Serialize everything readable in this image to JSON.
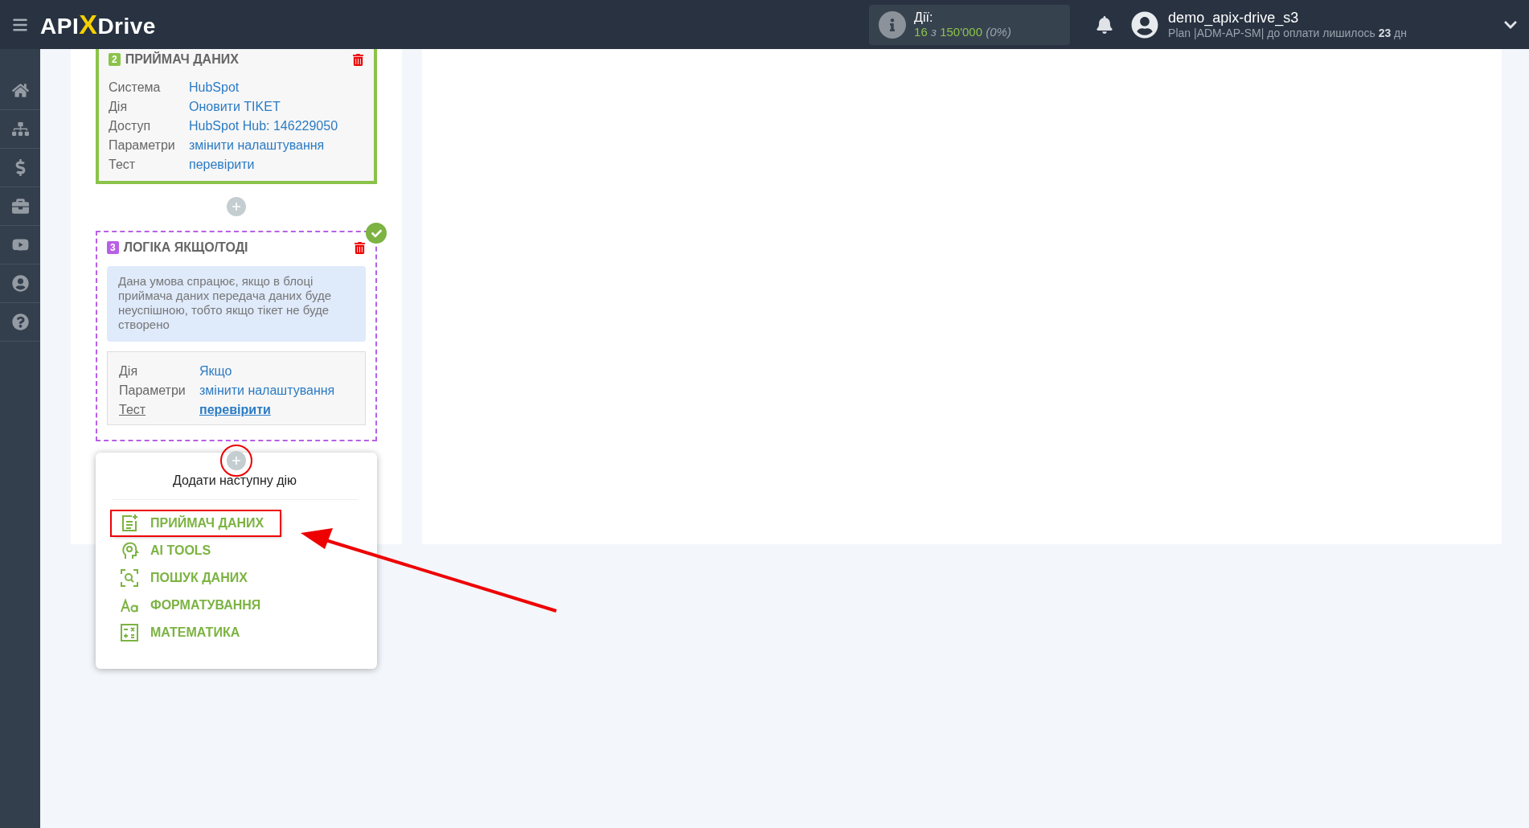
{
  "header": {
    "logo": {
      "left": "API",
      "mark": "X",
      "right": "Drive"
    },
    "actions": {
      "label": "Дії:",
      "used": "16",
      "of": "з",
      "limit": "150'000",
      "percent": "(0%)"
    },
    "user": {
      "name": "demo_apix-drive_s3",
      "plan": "Plan |ADM-AP-SM| до оплати лишилось **23** дн"
    }
  },
  "blocks": [
    {
      "kind": "receiver",
      "number": "2",
      "title": "ПРИЙМАЧ ДАНИХ",
      "done": false,
      "fields": [
        {
          "label": "Система",
          "value": "HubSpot",
          "underlined": false
        },
        {
          "label": "Дія",
          "value": "Оновити TIKET",
          "underlined": false
        },
        {
          "label": "Доступ",
          "value": "HubSpot Hub: 146229050",
          "underlined": false
        },
        {
          "label": "Параметри",
          "value": "змінити налаштування",
          "underlined": false
        },
        {
          "label": "Тест",
          "value": "перевірити",
          "underlined": false
        }
      ]
    },
    {
      "kind": "logic",
      "number": "3",
      "title": "ЛОГІКА ЯКЩО/ТОДІ",
      "done": true,
      "note": "Дана умова спрацює, якщо в блоці приймача даних передача даних буде неуспішною, тобто якщо тікет не буде створено",
      "fields": [
        {
          "label": "Дія",
          "value": "Якщо",
          "underlined": false
        },
        {
          "label": "Параметри",
          "value": "змінити налаштування",
          "underlined": false
        },
        {
          "label": "Тест",
          "value": "перевірити",
          "underlined": true
        }
      ]
    }
  ],
  "add_menu": {
    "title": "Додати наступну дію",
    "items": [
      {
        "label": "ПРИЙМАЧ ДАНИХ",
        "highlighted": true
      },
      {
        "label": "AI TOOLS",
        "highlighted": false
      },
      {
        "label": "ПОШУК ДАНИХ",
        "highlighted": false
      },
      {
        "label": "ФОРМАТУВАННЯ",
        "highlighted": false
      },
      {
        "label": "МАТЕМАТИКА",
        "highlighted": false
      }
    ]
  }
}
